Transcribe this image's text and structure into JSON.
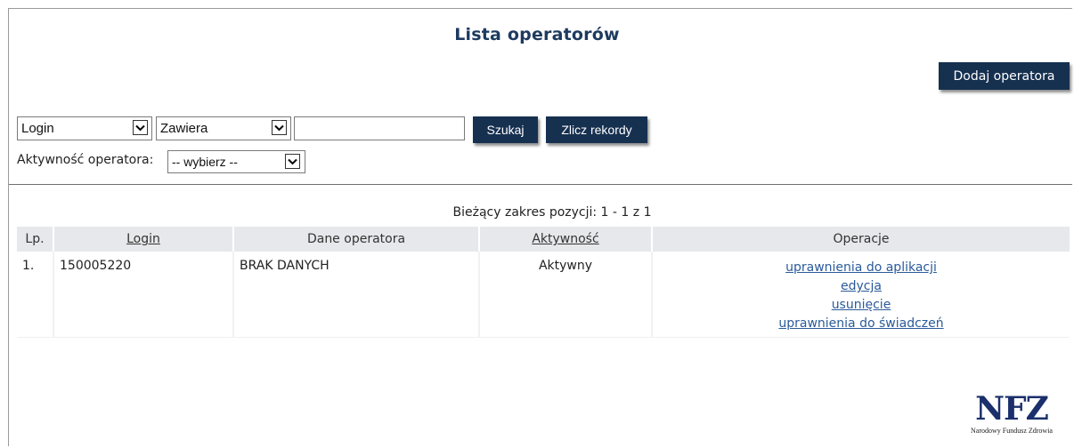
{
  "page": {
    "title": "Lista operatorów"
  },
  "toolbar": {
    "add_operator_label": "Dodaj operatora"
  },
  "filters": {
    "field_select": {
      "selected": "Login"
    },
    "condition_select": {
      "selected": "Zawiera"
    },
    "search_input": {
      "value": ""
    },
    "search_button_label": "Szukaj",
    "count_button_label": "Zlicz rekordy",
    "activity_label": "Aktywność operatora:",
    "activity_select": {
      "selected": "-- wybierz --"
    }
  },
  "results": {
    "range_text": "Bieżący zakres pozycji: 1 - 1 z 1",
    "columns": {
      "lp": "Lp.",
      "login": "Login",
      "dane": "Dane operatora",
      "aktywnosc": "Aktywność",
      "operacje": "Operacje"
    },
    "rows": [
      {
        "lp": "1.",
        "login": "150005220",
        "dane": "BRAK DANYCH",
        "aktywnosc": "Aktywny",
        "operations": [
          "uprawnienia do aplikacji",
          "edycja",
          "usunięcie",
          "uprawnienia do świadczeń"
        ]
      }
    ]
  },
  "footer": {
    "logo_mark": "NFZ",
    "logo_caption": "Narodowy Fundusz Zdrowia"
  },
  "colors": {
    "button_bg": "#163050",
    "title": "#1d3a5f",
    "link": "#2a5a9a",
    "header_bg": "#e6e8eb",
    "logo": "#1a2f6b"
  }
}
